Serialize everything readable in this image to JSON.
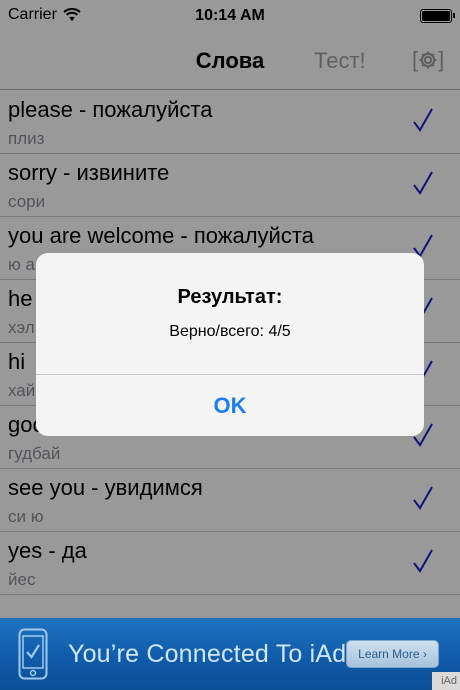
{
  "status_bar": {
    "carrier": "Carrier",
    "time": "10:14 AM"
  },
  "nav": {
    "title": "Слова",
    "test_button": "Тест!",
    "settings_open": "[",
    "settings_close": "]"
  },
  "rows": [
    {
      "phrase": "please - пожалуйста",
      "transcription": "плиз"
    },
    {
      "phrase": "sorry - извините",
      "transcription": "сори"
    },
    {
      "phrase": "you are welcome - пожалуйста",
      "transcription": "ю а"
    },
    {
      "phrase": "he",
      "transcription": "хэл"
    },
    {
      "phrase": "hi",
      "transcription": "хай"
    },
    {
      "phrase": "goo",
      "transcription": "гудбай"
    },
    {
      "phrase": "see you - увидимся",
      "transcription": "си ю"
    },
    {
      "phrase": "yes - да",
      "transcription": "йес"
    }
  ],
  "alert": {
    "title": "Результат:",
    "message": "Верно/всего: 4/5",
    "ok_button": "OK"
  },
  "ad": {
    "text": "You’re Connected To iAd",
    "learn_more": "Learn More ›",
    "badge": "iAd"
  },
  "colors": {
    "check": "#1f1fcf",
    "alert_button": "#1a7ff5",
    "ad_blue": "#1e73bf"
  }
}
